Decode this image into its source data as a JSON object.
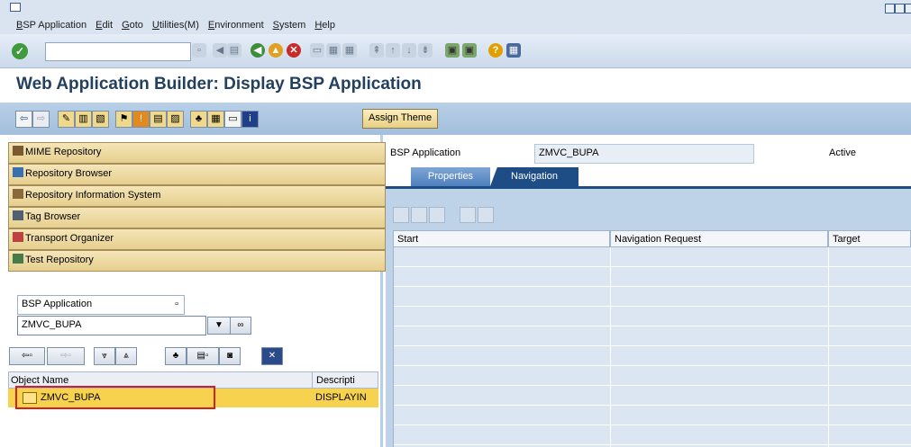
{
  "menu": [
    "BSP Application",
    "Edit",
    "Goto",
    "Utilities(M)",
    "Environment",
    "System",
    "Help"
  ],
  "title": "Web Application Builder: Display BSP Application",
  "app_toolbar": {
    "assign_theme": "Assign Theme"
  },
  "nav_buttons": [
    "MIME Repository",
    "Repository Browser",
    "Repository Information System",
    "Tag Browser",
    "Transport Organizer",
    "Test Repository"
  ],
  "object_list": {
    "type_value": "BSP Application",
    "name_value": "ZMVC_BUPA",
    "columns": {
      "name": "Object Name",
      "description": "Descripti"
    },
    "rows": [
      {
        "name": "ZMVC_BUPA",
        "description": "DISPLAYIN"
      }
    ]
  },
  "header": {
    "label": "BSP Application",
    "value": "ZMVC_BUPA",
    "status": "Active"
  },
  "tabs": [
    "Properties",
    "Navigation"
  ],
  "nav_table": {
    "columns": [
      "Start",
      "Navigation Request",
      "Target"
    ]
  },
  "colors": {
    "accent": "#1e4d85",
    "highlight": "#f7d24f",
    "selection_frame": "#d12020"
  }
}
